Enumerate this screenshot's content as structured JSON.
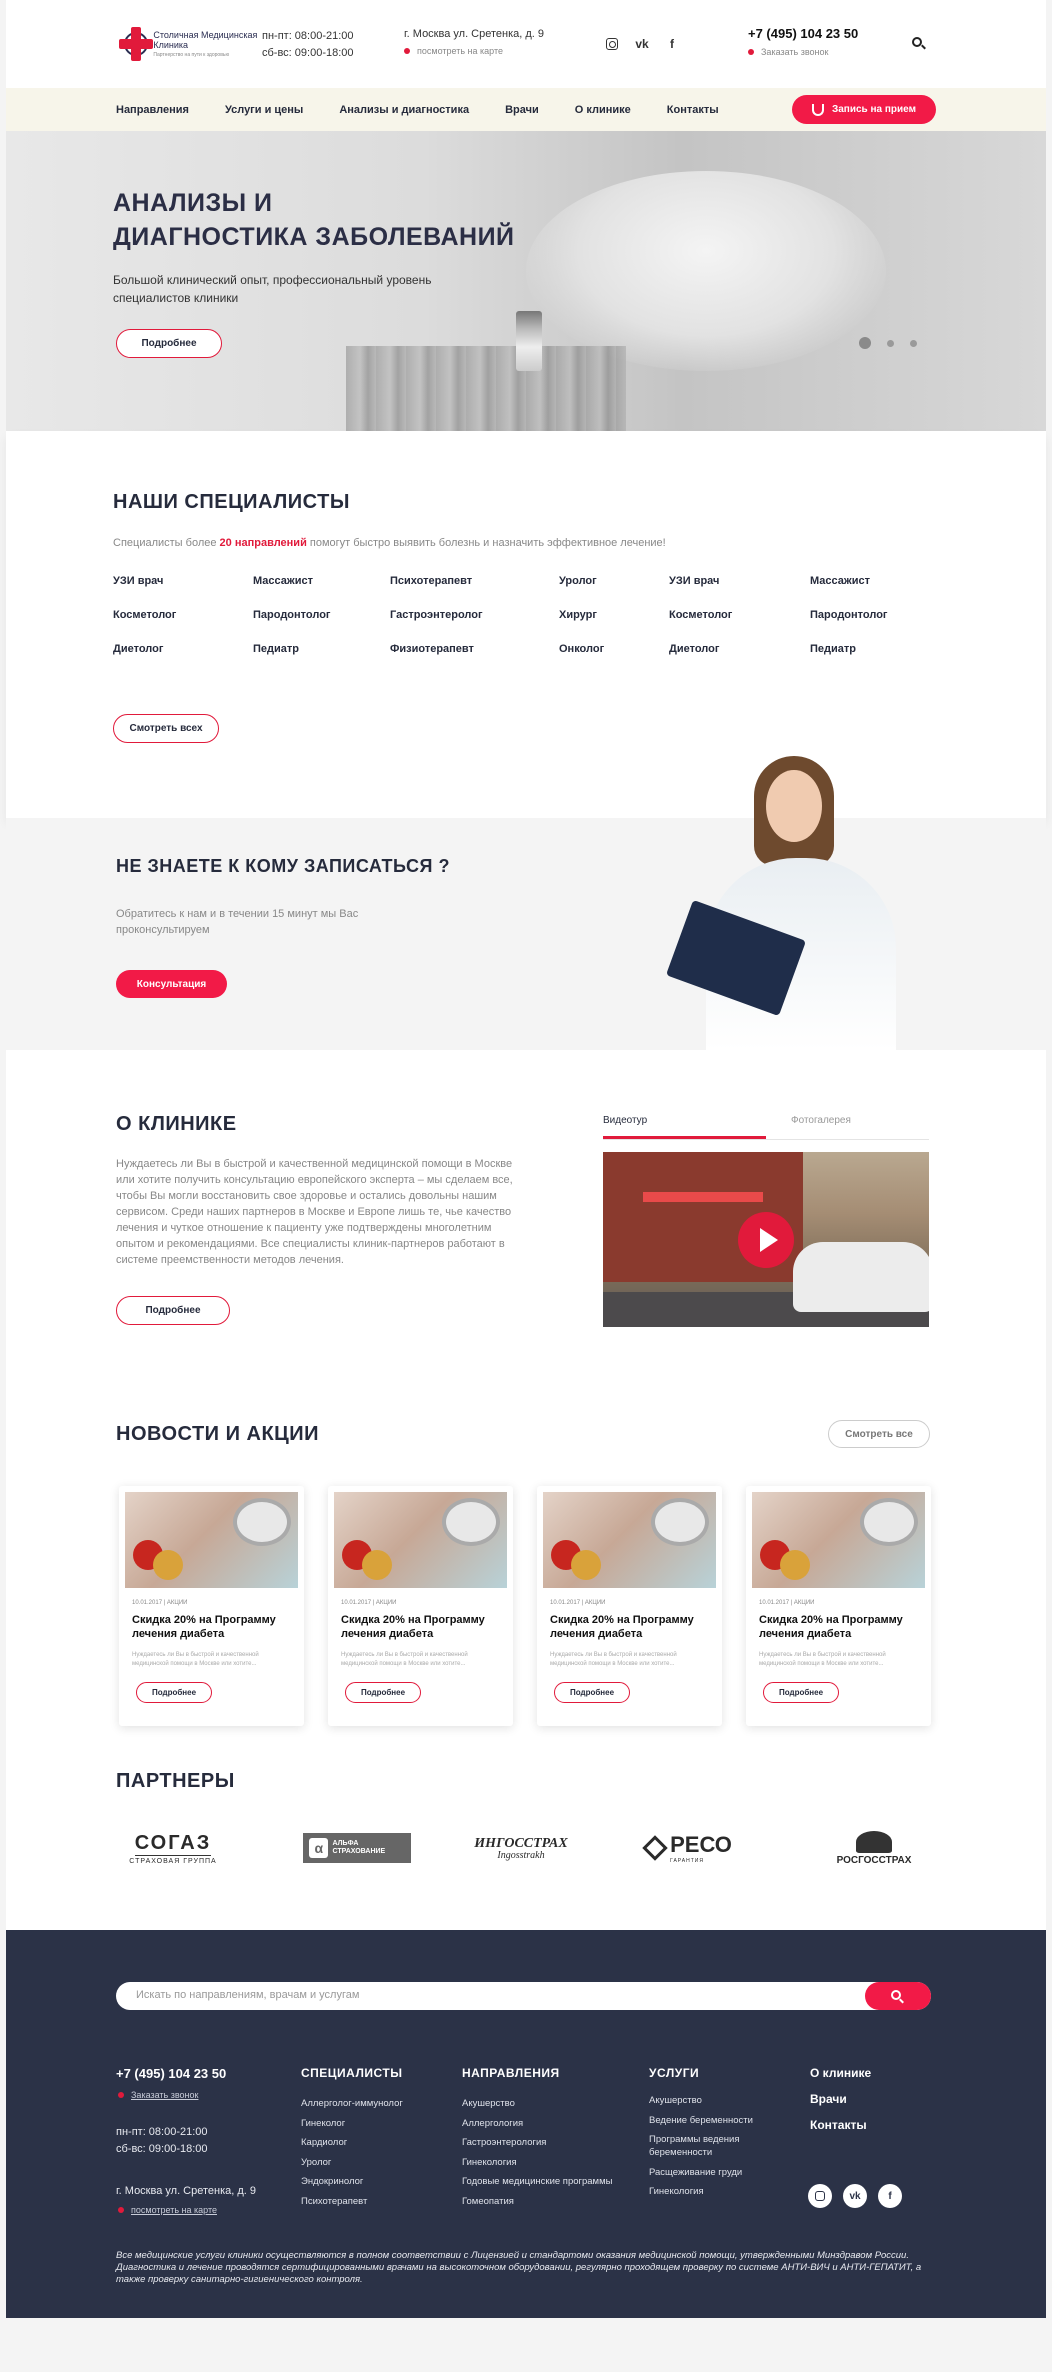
{
  "header": {
    "logo_text": "Столичная Медицинская Клиника",
    "logo_tagline": "Партнерство на пути к здоровью",
    "hours": [
      "пн-пт: 08:00-21:00",
      "сб-вс: 09:00-18:00"
    ],
    "address": "г. Москва ул. Сретенка, д. 9",
    "map_link": "посмотреть на карте",
    "socials": [
      "instagram-icon",
      "vk-icon",
      "facebook-icon"
    ],
    "phone": "+7 (495) 104 23 50",
    "callback": "Заказать звонок",
    "search_icon": "search-icon"
  },
  "nav": {
    "items": [
      "Направления",
      "Услуги и цены",
      "Анализы и диагностика",
      "Врачи",
      "О клинике",
      "Контакты"
    ],
    "cta": "Запись на прием"
  },
  "hero": {
    "title_line1": "АНАЛИЗЫ И",
    "title_line2": "ДИАГНОСТИКА ЗАБОЛЕВАНИЙ",
    "text": "Большой клинический опыт, профессиональный уровень специалистов клиники",
    "button": "Подробнее",
    "slides": 3,
    "active_slide": 1
  },
  "specialists": {
    "title": "НАШИ СПЕЦИАЛИСТЫ",
    "lead_before": "Специалисты более",
    "lead_highlight": "20 направлений",
    "lead_after": "помогут быстро выявить болезнь и назначить эффективное лечение!",
    "items": [
      "УЗИ врач",
      "Массажист",
      "Психотерапевт",
      "Уролог",
      "УЗИ врач",
      "Массажист",
      "Косметолог",
      "Пародонтолог",
      "Гастроэнтеролог",
      "Хирург",
      "Косметолог",
      "Пародонтолог",
      "Диетолог",
      "Педиатр",
      "Физиотерапевт",
      "Онколог",
      "Диетолог",
      "Педиатр"
    ],
    "button": "Смотреть всех"
  },
  "consult": {
    "title": "НЕ ЗНАЕТЕ К КОМУ ЗАПИСАТЬСЯ ?",
    "text": "Обратитесь к нам и в течении 15 минут мы Вас проконсультируем",
    "button": "Консультация"
  },
  "about": {
    "title": "О КЛИНИКЕ",
    "text": "Нуждаетесь ли Вы в быстрой и качественной медицинской помощи в Москве или хотите получить консультацию европейского эксперта – мы сделаем все, чтобы Вы могли восстановить свое здоровье и остались довольны нашим сервисом. Среди наших партнеров в Москве и Европе лишь те, чье качество лечения и чуткое отношение к пациенту уже подтверждены многолетним опытом и рекомендациями. Все специалисты клиник-партнеров работают в системе преемственности методов лечения.",
    "button": "Подробнее",
    "tabs": [
      "Видеотур",
      "Фотогалерея"
    ]
  },
  "news": {
    "title": "НОВОСТИ И АКЦИИ",
    "see_all": "Смотреть все",
    "cards": [
      {
        "date": "10.01.2017 | АКЦИИ",
        "title": "Скидка 20% на Программу лечения диабета",
        "text": "Нуждаетесь ли Вы в быстрой и качественной медицинской помощи в Москве или хотите...",
        "button": "Подробнее"
      },
      {
        "date": "10.01.2017 | АКЦИИ",
        "title": "Скидка 20% на Программу лечения диабета",
        "text": "Нуждаетесь ли Вы в быстрой и качественной медицинской помощи в Москве или хотите...",
        "button": "Подробнее"
      },
      {
        "date": "10.01.2017 | АКЦИИ",
        "title": "Скидка 20% на Программу лечения диабета",
        "text": "Нуждаетесь ли Вы в быстрой и качественной медицинской помощи в Москве или хотите...",
        "button": "Подробнее"
      },
      {
        "date": "10.01.2017 | АКЦИИ",
        "title": "Скидка 20% на Программу лечения диабета",
        "text": "Нуждаетесь ли Вы в быстрой и качественной медицинской помощи в Москве или хотите...",
        "button": "Подробнее"
      }
    ]
  },
  "partners": {
    "title": "ПАРТНЕРЫ",
    "logos": [
      {
        "main": "СОГАЗ",
        "sub": "СТРАХОВАЯ ГРУППА"
      },
      {
        "main": "АЛЬФА СТРАХОВАНИЕ",
        "sub": "α"
      },
      {
        "main": "ИНГОССТРАХ",
        "sub": "Ingosstrakh"
      },
      {
        "main": "РЕСО",
        "sub": "ГАРАНТИЯ"
      },
      {
        "main": "РОСГОССТРАХ",
        "sub": "РОСГОССТРАХ"
      }
    ]
  },
  "footer": {
    "search_placeholder": "Искать по направлениям, врачам и услугам",
    "phone": "+7 (495) 104 23 50",
    "callback": "Заказать звонок",
    "hours": [
      "пн-пт: 08:00-21:00",
      "сб-вс: 09:00-18:00"
    ],
    "address": "г. Москва ул. Сретенка, д. 9",
    "map_link": "посмотреть на карте",
    "specialists": {
      "title": "СПЕЦИАЛИСТЫ",
      "items": [
        "Аллерголог-иммунолог",
        "Гинеколог",
        "Кардиолог",
        "Уролог",
        "Эндокринолог",
        "Психотерапевт"
      ]
    },
    "directions": {
      "title": "НАПРАВЛЕНИЯ",
      "items": [
        "Акушерство",
        "Аллергология",
        "Гастроэнтерология",
        "Гинекология",
        "Годовые медицинские программы",
        "Гомеопатия"
      ]
    },
    "services": {
      "title": "УСЛУГИ",
      "items": [
        "Акушерство",
        "Ведение беременности",
        "Программы ведения беременности",
        "Расщеживание груди",
        "Гинекология"
      ]
    },
    "links": [
      "О клинике",
      "Врачи",
      "Контакты"
    ],
    "socials": [
      "instagram-icon",
      "vk-icon",
      "facebook-icon"
    ],
    "legal": "Все медицинские услуги клиники осуществляются в полном соответствии с Лицензией и стандартоми оказания медицинской помощи, утвержденными Минздравом России. Диагностика и лечение проводятся сертифицированными врачами на высокоточном оборудовании, регулярно проходящем проверку по системе АНТИ-ВИЧ и АНТИ-ГЕПАТИТ, а также проверку санитарно-гигиенического контроля."
  }
}
